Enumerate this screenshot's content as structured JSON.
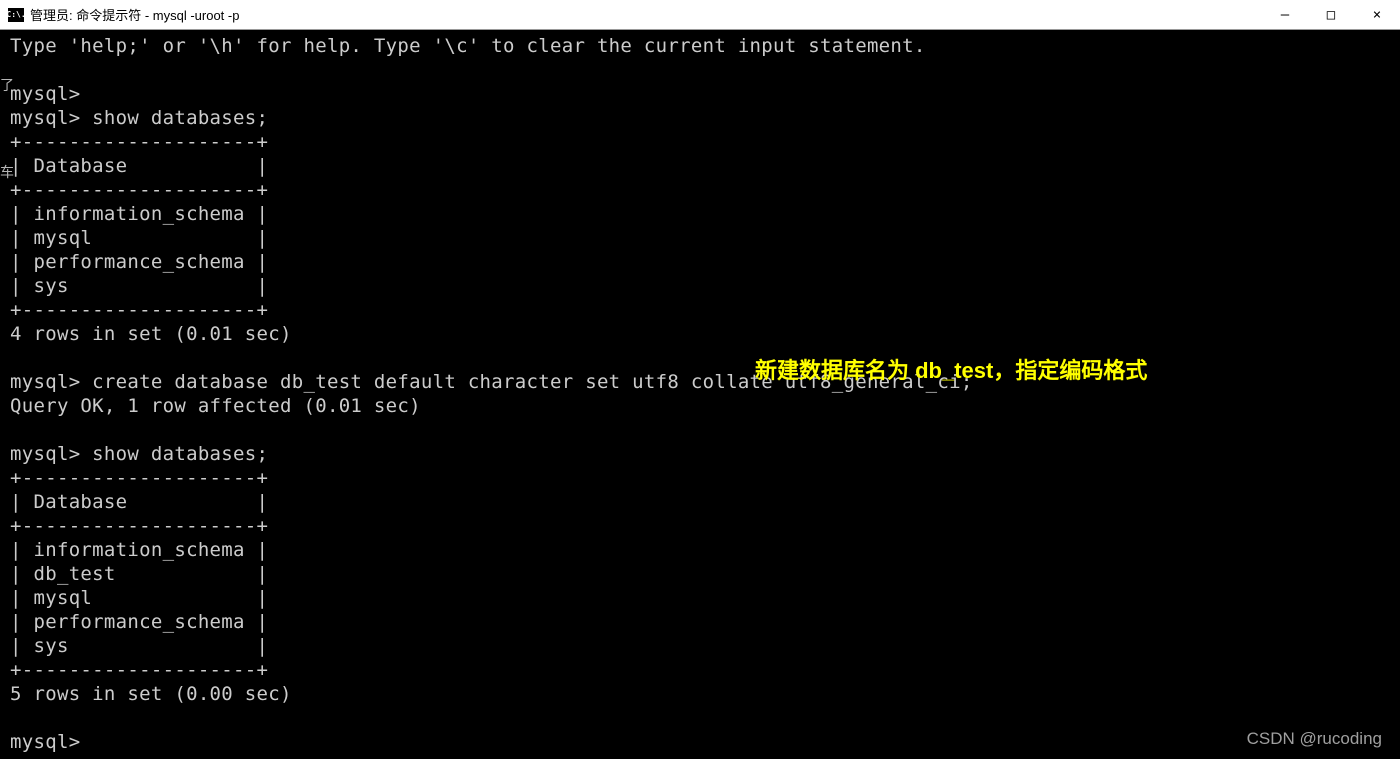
{
  "window": {
    "icon_text": "C:\\.",
    "title": "管理员: 命令提示符 - mysql  -uroot -p"
  },
  "window_controls": {
    "minimize": "—",
    "maximize": "□",
    "close": "×"
  },
  "side_text": {
    "s1": "了",
    "s2": "车"
  },
  "terminal": {
    "line1": "Type 'help;' or '\\h' for help. Type '\\c' to clear the current input statement.",
    "line2": "",
    "line3": "mysql>",
    "line4": "mysql> show databases;",
    "line5": "+--------------------+",
    "line6": "| Database           |",
    "line7": "+--------------------+",
    "line8": "| information_schema |",
    "line9": "| mysql              |",
    "line10": "| performance_schema |",
    "line11": "| sys                |",
    "line12": "+--------------------+",
    "line13": "4 rows in set (0.01 sec)",
    "line14": "",
    "line15": "mysql> create database db_test default character set utf8 collate utf8_general_ci;",
    "line16": "Query OK, 1 row affected (0.01 sec)",
    "line17": "",
    "line18": "mysql> show databases;",
    "line19": "+--------------------+",
    "line20": "| Database           |",
    "line21": "+--------------------+",
    "line22": "| information_schema |",
    "line23": "| db_test            |",
    "line24": "| mysql              |",
    "line25": "| performance_schema |",
    "line26": "| sys                |",
    "line27": "+--------------------+",
    "line28": "5 rows in set (0.00 sec)",
    "line29": "",
    "line30": "mysql>"
  },
  "annotation": "新建数据库名为 db_test，指定编码格式",
  "watermark": "CSDN @rucoding"
}
